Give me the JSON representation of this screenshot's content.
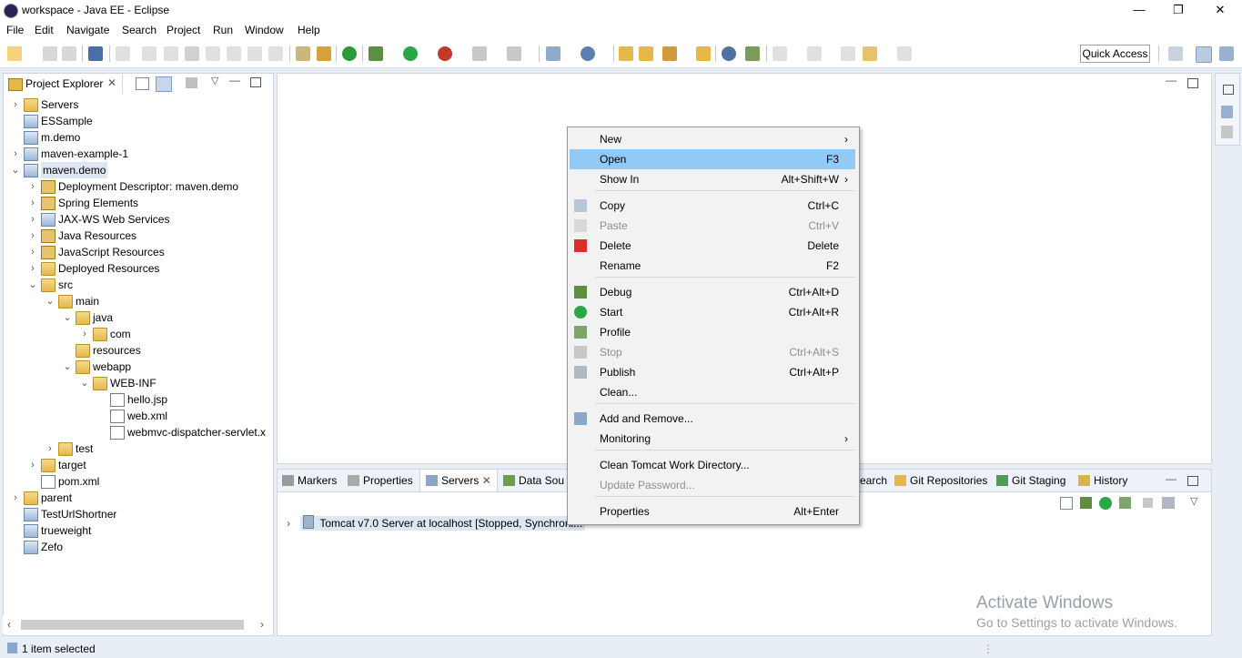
{
  "window": {
    "title": "workspace - Java EE - Eclipse",
    "minimize": "—",
    "restore": "❐",
    "close": "✕"
  },
  "menubar": [
    "File",
    "Edit",
    "Navigate",
    "Search",
    "Project",
    "Run",
    "Window",
    "Help"
  ],
  "toolbar": {
    "quick_access": "Quick Access"
  },
  "explorer": {
    "tab_title": "Project Explorer",
    "tree": [
      {
        "label": "Servers",
        "twist": "›",
        "icon": "folder-icon"
      },
      {
        "label": "ESSample",
        "twist": "",
        "icon": "project-icon"
      },
      {
        "label": "m.demo",
        "twist": "",
        "icon": "project-icon"
      },
      {
        "label": "maven-example-1",
        "twist": "›",
        "icon": "maven-project-icon"
      },
      {
        "label": "maven.demo",
        "twist": "⌄",
        "icon": "maven-project-icon",
        "selected": true
      },
      {
        "label": "Deployment Descriptor: maven.demo",
        "twist": "›",
        "icon": "deployment-descriptor-icon"
      },
      {
        "label": "Spring Elements",
        "twist": "›",
        "icon": "spring-icon"
      },
      {
        "label": "JAX-WS Web Services",
        "twist": "›",
        "icon": "webservices-icon"
      },
      {
        "label": "Java Resources",
        "twist": "›",
        "icon": "java-resources-icon"
      },
      {
        "label": "JavaScript Resources",
        "twist": "›",
        "icon": "javascript-resources-icon"
      },
      {
        "label": "Deployed Resources",
        "twist": "›",
        "icon": "deployed-resources-icon"
      },
      {
        "label": "src",
        "twist": "⌄",
        "icon": "folder-icon"
      },
      {
        "label": "main",
        "twist": "⌄",
        "icon": "folder-icon"
      },
      {
        "label": "java",
        "twist": "⌄",
        "icon": "folder-icon"
      },
      {
        "label": "com",
        "twist": "›",
        "icon": "folder-icon"
      },
      {
        "label": "resources",
        "twist": "",
        "icon": "folder-icon"
      },
      {
        "label": "webapp",
        "twist": "⌄",
        "icon": "folder-icon"
      },
      {
        "label": "WEB-INF",
        "twist": "⌄",
        "icon": "folder-icon"
      },
      {
        "label": "hello.jsp",
        "twist": "",
        "icon": "jsp-file-icon"
      },
      {
        "label": "web.xml",
        "twist": "",
        "icon": "xml-file-icon"
      },
      {
        "label": "webmvc-dispatcher-servlet.x",
        "twist": "",
        "icon": "xml-file-icon"
      },
      {
        "label": "test",
        "twist": "›",
        "icon": "folder-icon"
      },
      {
        "label": "target",
        "twist": "›",
        "icon": "folder-icon"
      },
      {
        "label": "pom.xml",
        "twist": "",
        "icon": "xml-file-icon"
      },
      {
        "label": "parent",
        "twist": "›",
        "icon": "folder-icon"
      },
      {
        "label": "TestUrlShortner",
        "twist": "",
        "icon": "project-icon"
      },
      {
        "label": "trueweight",
        "twist": "",
        "icon": "project-icon"
      },
      {
        "label": "Zefo",
        "twist": "",
        "icon": "project-icon"
      }
    ]
  },
  "bottom_panel": {
    "tabs": [
      "Markers",
      "Properties",
      "Servers",
      "Data Sou",
      "earch",
      "Git Repositories",
      "Git Staging",
      "History"
    ],
    "server_entry": "Tomcat v7.0 Server at localhost  [Stopped, Synchroni..."
  },
  "context_menu": {
    "items": [
      {
        "label": "New",
        "accel": "",
        "submenu": true,
        "disabled": false,
        "icon": ""
      },
      {
        "label": "Open",
        "accel": "F3",
        "submenu": false,
        "disabled": false,
        "highlight": true,
        "icon": ""
      },
      {
        "label": "Show In",
        "accel": "Alt+Shift+W",
        "submenu": true,
        "disabled": false,
        "icon": ""
      },
      {
        "label": "Copy",
        "accel": "Ctrl+C",
        "disabled": false,
        "icon": "copy-icon"
      },
      {
        "label": "Paste",
        "accel": "Ctrl+V",
        "disabled": true,
        "icon": "paste-icon"
      },
      {
        "label": "Delete",
        "accel": "Delete",
        "disabled": false,
        "icon": "delete-icon"
      },
      {
        "label": "Rename",
        "accel": "F2",
        "disabled": false,
        "icon": ""
      },
      {
        "label": "Debug",
        "accel": "Ctrl+Alt+D",
        "disabled": false,
        "icon": "debug-icon"
      },
      {
        "label": "Start",
        "accel": "Ctrl+Alt+R",
        "disabled": false,
        "icon": "start-icon"
      },
      {
        "label": "Profile",
        "accel": "",
        "disabled": false,
        "icon": "profile-icon"
      },
      {
        "label": "Stop",
        "accel": "Ctrl+Alt+S",
        "disabled": true,
        "icon": "stop-icon"
      },
      {
        "label": "Publish",
        "accel": "Ctrl+Alt+P",
        "disabled": false,
        "icon": "publish-icon"
      },
      {
        "label": "Clean...",
        "accel": "",
        "disabled": false,
        "icon": ""
      },
      {
        "label": "Add and Remove...",
        "accel": "",
        "disabled": false,
        "icon": "add-remove-icon"
      },
      {
        "label": "Monitoring",
        "accel": "",
        "submenu": true,
        "disabled": false,
        "icon": ""
      },
      {
        "label": "Clean Tomcat Work Directory...",
        "accel": "",
        "disabled": false,
        "icon": ""
      },
      {
        "label": "Update Password...",
        "accel": "",
        "disabled": true,
        "icon": ""
      },
      {
        "label": "Properties",
        "accel": "Alt+Enter",
        "disabled": false,
        "icon": ""
      }
    ]
  },
  "statusbar": {
    "text": "1 item selected"
  },
  "watermark": {
    "line1": "Activate Windows",
    "line2": "Go to Settings to activate Windows."
  },
  "colors": {
    "highlight": "#91c9f7",
    "selection": "#dde6f2",
    "background": "#e8eef6"
  }
}
